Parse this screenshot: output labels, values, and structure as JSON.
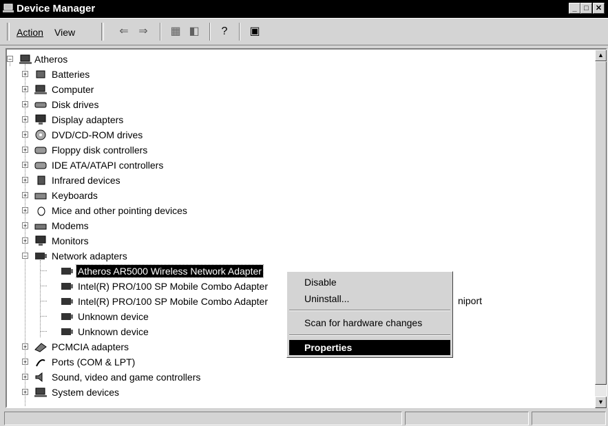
{
  "window": {
    "title": "Device Manager"
  },
  "menu": {
    "action": "Action",
    "view": "View"
  },
  "toolbar": [
    "back-icon",
    "forward-icon",
    "view-icon",
    "properties-icon",
    "help-icon",
    "scan-icon"
  ],
  "tree": {
    "root": "Atheros",
    "categories": [
      "Batteries",
      "Computer",
      "Disk drives",
      "Display adapters",
      "DVD/CD-ROM drives",
      "Floppy disk controllers",
      "IDE ATA/ATAPI controllers",
      "Infrared devices",
      "Keyboards",
      "Mice and other pointing devices",
      "Modems",
      "Monitors",
      "Network adapters"
    ],
    "network_children": [
      "Atheros AR5000 Wireless Network Adapter",
      "Intel(R) PRO/100 SP Mobile Combo Adapter",
      "Intel(R) PRO/100 SP Mobile Combo Adapter",
      "Unknown device",
      "Unknown device"
    ],
    "hidden_suffix": "niport",
    "after": [
      "PCMCIA adapters",
      "Ports (COM & LPT)",
      "Sound, video and game controllers",
      "System devices"
    ]
  },
  "context_menu": {
    "disable": "Disable",
    "uninstall": "Uninstall...",
    "scan": "Scan for hardware changes",
    "properties": "Properties"
  }
}
